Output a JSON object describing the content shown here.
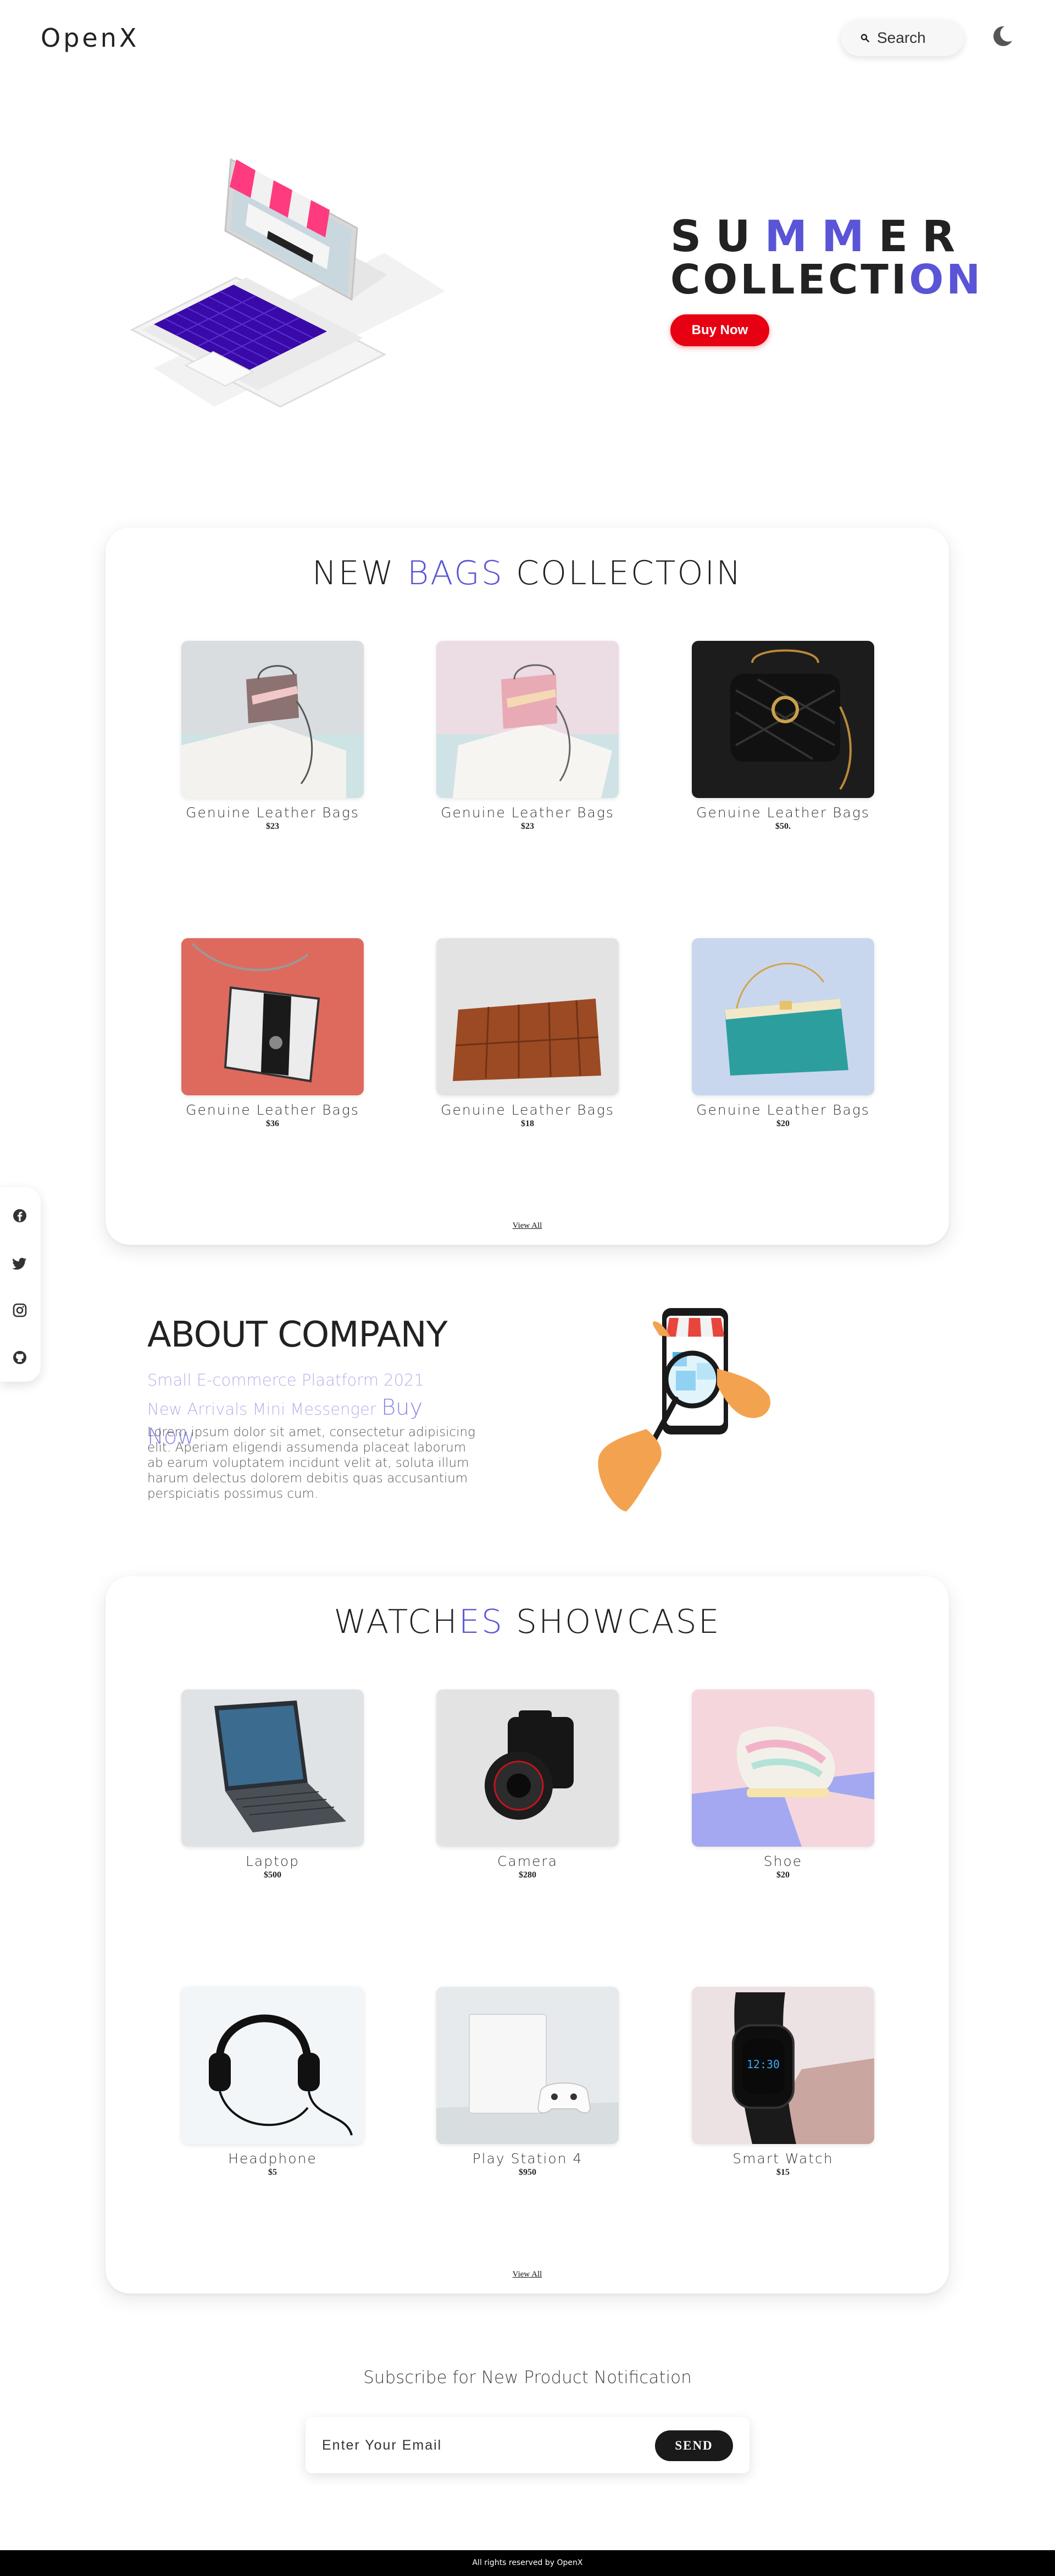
{
  "header": {
    "logo": "OpenX",
    "search_placeholder": "Search",
    "icons": {
      "search": "search-icon",
      "theme": "moon-icon"
    }
  },
  "hero": {
    "title_line1_part1": "SU",
    "title_line1_accent": "MM",
    "title_line1_part2": "ER",
    "title_line2_part1": "COLLECTI",
    "title_line2_accent": "ON",
    "button_label": "Buy Now"
  },
  "bags": {
    "title_part1": "NEW ",
    "title_accent": "BAGS",
    "title_part2": " COLLECTOIN",
    "products": [
      {
        "name": "Genuine Leather Bags",
        "price": "$23"
      },
      {
        "name": "Genuine Leather Bags",
        "price": "$23"
      },
      {
        "name": "Genuine Leather Bags",
        "price": "$50."
      },
      {
        "name": "Genuine Leather Bags",
        "price": "$36"
      },
      {
        "name": "Genuine Leather Bags",
        "price": "$18"
      },
      {
        "name": "Genuine Leather Bags",
        "price": "$20"
      }
    ],
    "view_all": "View All"
  },
  "social": [
    "facebook-icon",
    "twitter-icon",
    "instagram-icon",
    "github-icon"
  ],
  "about": {
    "title": "ABOUT COMPANY",
    "tagline": "Small E-commerce Plaatform 2021 New Arrivals Mini Messenger",
    "tagline_big": "Buy Now",
    "text": "Lorem ipsum dolor sit amet, consectetur adipisicing elit. Aperiam eligendi assumenda placeat laborum ab earum voluptatem incidunt velit at, soluta illum harum delectus dolorem debitis quas accusantium perspiciatis possimus cum."
  },
  "watches": {
    "title_part1": "WATCH",
    "title_accent": "ES",
    "title_part2": " SHOWCASE",
    "products": [
      {
        "name": "Laptop",
        "price": "$500"
      },
      {
        "name": "Camera",
        "price": "$280"
      },
      {
        "name": "Shoe",
        "price": "$20"
      },
      {
        "name": "Headphone",
        "price": "$5"
      },
      {
        "name": "Play Station 4",
        "price": "$950"
      },
      {
        "name": "Smart Watch",
        "price": "$15"
      }
    ],
    "view_all": "View All"
  },
  "subscribe": {
    "title": "Subscribe for New Product Notification",
    "placeholder": "Enter Your Email",
    "button": "SEND"
  },
  "footer": {
    "text": "All rights reserved by OpenX"
  },
  "colors": {
    "accent": "#5a55d6",
    "buy_button": "#e60012",
    "send_button": "#1a1a1a",
    "footer": "#000000"
  }
}
